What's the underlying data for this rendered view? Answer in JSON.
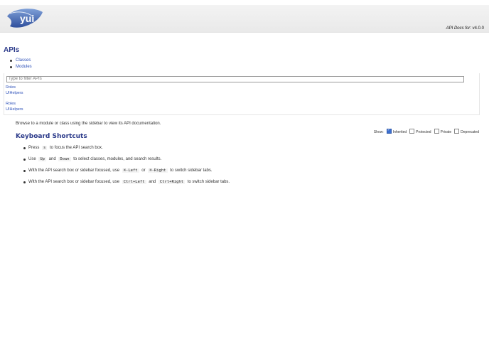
{
  "header": {
    "logo_text": "yui",
    "version_label": "API Docs for:",
    "version_value": "v4.0.0"
  },
  "sidebar": {
    "title": "APIs",
    "tabs": [
      {
        "label": "Classes"
      },
      {
        "label": "Modules"
      }
    ],
    "filter_placeholder": "Type to filter APIs",
    "groups": [
      {
        "items": [
          "Roles",
          "UIHelpers"
        ]
      },
      {
        "items": [
          "Roles",
          "UIHelpers"
        ]
      }
    ]
  },
  "main": {
    "browse_text": "Browse to a module or class using the sidebar to view its API documentation.",
    "show": {
      "label": "Show:",
      "options": [
        {
          "label": "Inherited",
          "checked": true
        },
        {
          "label": "Protected",
          "checked": false
        },
        {
          "label": "Private",
          "checked": false
        },
        {
          "label": "Deprecated",
          "checked": false
        }
      ]
    },
    "shortcuts_title": "Keyboard Shortcuts",
    "shortcuts": {
      "s1": {
        "pre": "Press",
        "key": "s",
        "post": "to focus the API search box."
      },
      "s2": {
        "pre": "Use",
        "key1": "Up",
        "mid": "and",
        "key2": "Down",
        "post": "to select classes, modules, and search results."
      },
      "s3": {
        "pre": "With the API search box or sidebar focused, use",
        "key1": "⌘-Left",
        "mid": "or",
        "key2": "⌘-Right",
        "post": "to switch sidebar tabs."
      },
      "s4": {
        "pre": "With the API search box or sidebar focused, use",
        "key1": "Ctrl+Left",
        "mid": "and",
        "key2": "Ctrl+Right",
        "post": "to switch sidebar tabs."
      }
    }
  }
}
